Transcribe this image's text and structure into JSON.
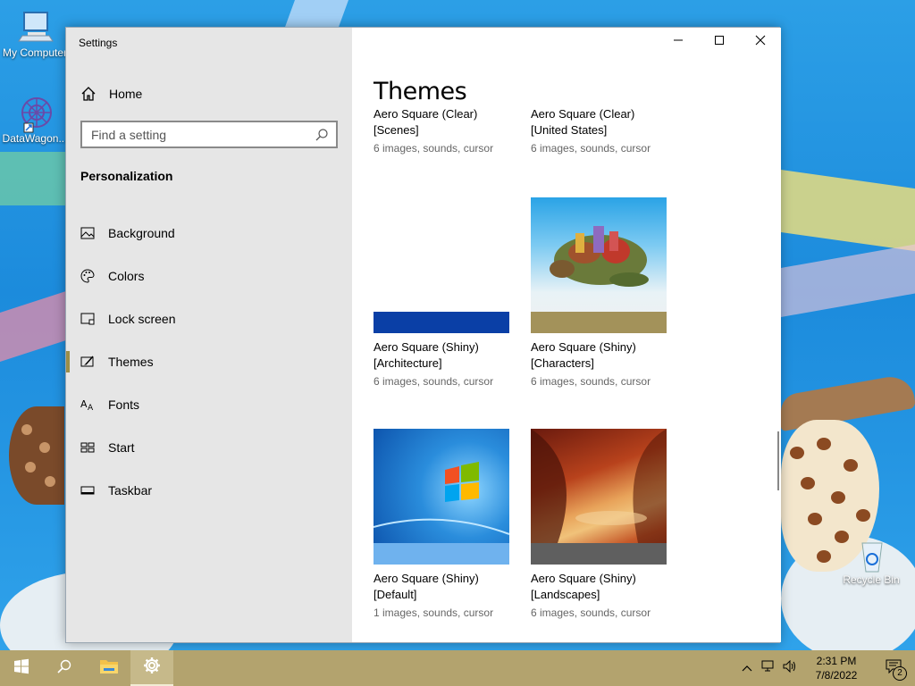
{
  "desktop": {
    "icons": [
      {
        "label": "My Computer",
        "icon": "monitor-icon"
      },
      {
        "label": "DataWagon...",
        "icon": "app-shortcut-icon"
      },
      {
        "label": "Recycle Bin",
        "icon": "recycle-bin-icon"
      }
    ]
  },
  "window": {
    "title": "Settings",
    "caption": {
      "minimize": "minimize-icon",
      "maximize": "maximize-icon",
      "close": "close-icon"
    }
  },
  "sidebar": {
    "home_label": "Home",
    "search_placeholder": "Find a setting",
    "section_title": "Personalization",
    "items": [
      {
        "label": "Background",
        "icon": "picture-icon"
      },
      {
        "label": "Colors",
        "icon": "palette-icon"
      },
      {
        "label": "Lock screen",
        "icon": "lock-screen-icon"
      },
      {
        "label": "Themes",
        "icon": "brush-icon",
        "active": true
      },
      {
        "label": "Fonts",
        "icon": "font-icon"
      },
      {
        "label": "Start",
        "icon": "start-grid-icon"
      },
      {
        "label": "Taskbar",
        "icon": "taskbar-icon"
      }
    ]
  },
  "main": {
    "title": "Themes",
    "themes": [
      {
        "name_line1": "Aero Square (Clear)",
        "name_line2": "[Scenes]",
        "meta": "6 images, sounds, cursor",
        "bar_color": "#ffffff"
      },
      {
        "name_line1": "Aero Square (Clear)",
        "name_line2": "[United States]",
        "meta": "6 images, sounds, cursor",
        "bar_color": "#ffffff"
      },
      {
        "name_line1": "Aero Square (Shiny)",
        "name_line2": "[Architecture]",
        "meta": "6 images, sounds, cursor",
        "bar_color": "#0a3fa6"
      },
      {
        "name_line1": "Aero Square (Shiny)",
        "name_line2": "[Characters]",
        "meta": "6 images, sounds, cursor",
        "bar_color": "#a3925a"
      },
      {
        "name_line1": "Aero Square (Shiny)",
        "name_line2": "[Default]",
        "meta": "1 images, sounds, cursor",
        "bar_color": "#6fb2ee"
      },
      {
        "name_line1": "Aero Square (Shiny)",
        "name_line2": "[Landscapes]",
        "meta": "6 images, sounds, cursor",
        "bar_color": "#5f5f5f"
      }
    ]
  },
  "taskbar": {
    "buttons": [
      "start-windows-icon",
      "search-icon",
      "file-explorer-icon",
      "settings-gear-icon"
    ],
    "tray_icons": [
      "chevron-up-icon",
      "network-icon",
      "volume-icon"
    ],
    "time": "2:31 PM",
    "date": "7/8/2022",
    "notification_count": "2",
    "accent": "#b3a36e"
  }
}
